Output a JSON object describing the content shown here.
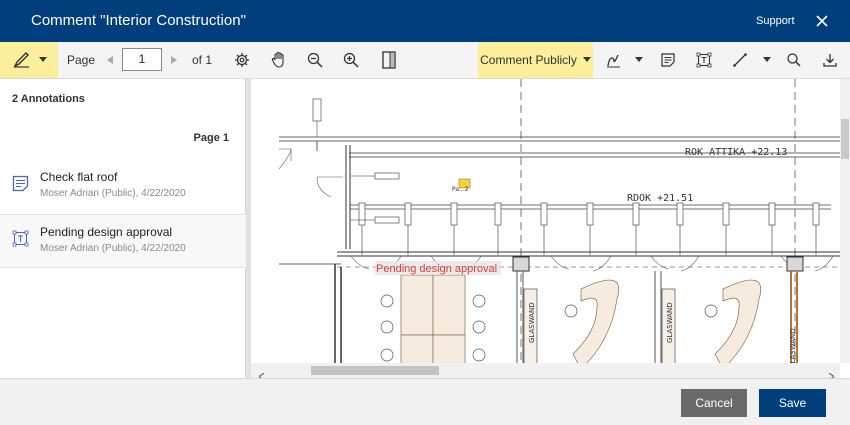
{
  "title": "Comment \"Interior Construction\"",
  "support_label": "Support",
  "toolbar": {
    "page_label": "Page",
    "page_value": "1",
    "of_label": "of 1",
    "comment_publicly": "Comment Publicly"
  },
  "annotations": {
    "header": "2 Annotations",
    "page_label": "Page 1",
    "items": [
      {
        "title": "Check flat roof",
        "meta": "Moser Adrian (Public), 4/22/2020"
      },
      {
        "title": "Pending design approval",
        "meta": "Moser Adrian (Public), 4/22/2020"
      }
    ]
  },
  "drawing": {
    "label_rok": "ROK ATTIKA +22.13",
    "label_rdok": "RDOK +21.51",
    "markup_text": "Pending design approval",
    "note_text": "Pa...2",
    "glaswand": "GLASWAND"
  },
  "footer": {
    "cancel": "Cancel",
    "save": "Save"
  },
  "colors": {
    "brand": "#003f7c",
    "highlight": "#fbef9b",
    "markup": "#e53935"
  }
}
